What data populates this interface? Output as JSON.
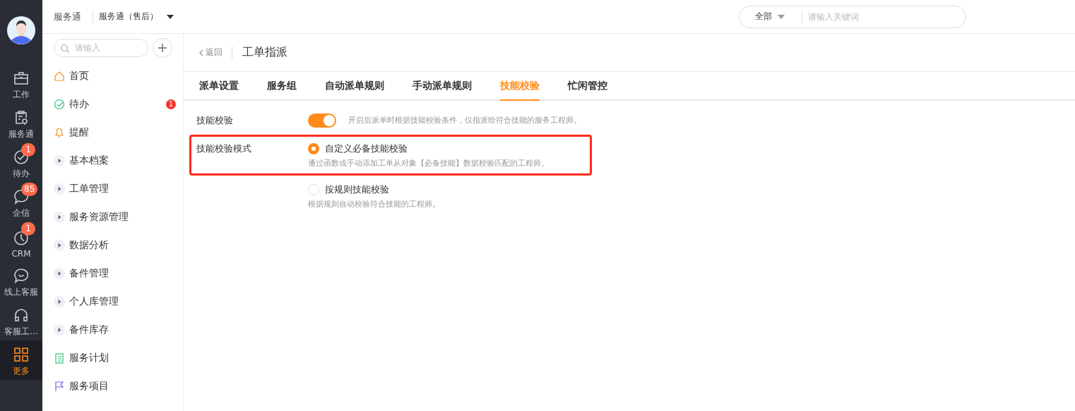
{
  "rail": [
    {
      "label": "工作",
      "selected": false
    },
    {
      "label": "服务通",
      "selected": false
    },
    {
      "label": "待办",
      "badge": "1",
      "selected": false
    },
    {
      "label": "企信",
      "badge": "85",
      "selected": false
    },
    {
      "label": "CRM",
      "badge": "1",
      "selected": false
    },
    {
      "label": "线上客服",
      "selected": false
    },
    {
      "label": "客服工…",
      "selected": false
    },
    {
      "label": "更多",
      "selected": true
    }
  ],
  "top_bar": {
    "app_name": "服务通",
    "app_switch": "服务通（售后）",
    "search": {
      "scope": "全部",
      "placeholder": "请输入关键词"
    }
  },
  "sidebar": {
    "search": {
      "placeholder": "请输入"
    },
    "items": [
      {
        "label": "首页"
      },
      {
        "label": "待办",
        "badge": "1"
      },
      {
        "label": "提醒"
      },
      {
        "label": "基本档案",
        "expanded": false
      },
      {
        "label": "工单管理",
        "expanded": false
      },
      {
        "label": "服务资源管理",
        "expanded": false
      },
      {
        "label": "数据分析",
        "expanded": false
      },
      {
        "label": "备件管理",
        "expanded": false
      },
      {
        "label": "个人库管理",
        "expanded": false
      },
      {
        "label": "备件库存",
        "expanded": false
      },
      {
        "label": "服务计划"
      },
      {
        "label": "服务项目"
      }
    ]
  },
  "page": {
    "back": "返回",
    "title": "工单指派"
  },
  "tabs": [
    {
      "label": "派单设置",
      "selected": false
    },
    {
      "label": "服务组",
      "selected": false
    },
    {
      "label": "自动派单规则",
      "selected": false
    },
    {
      "label": "手动派单规则",
      "selected": false
    },
    {
      "label": "技能校验",
      "selected": true
    },
    {
      "label": "忙闲管控",
      "selected": false
    }
  ],
  "settings": [
    {
      "kind": "toggle",
      "label": "技能校验",
      "on": true,
      "hint": "开启后派单时根据技能校验条件，仅指派给符合技能的服务工程师。"
    },
    {
      "kind": "radio",
      "label": "技能校验模式",
      "highlighted": true,
      "options": [
        {
          "label": "自定义必备技能校验",
          "hint": "通过函数或手动添加工单从对象【必备技能】数据校验匹配的工程师。",
          "selected": true
        }
      ]
    },
    {
      "kind": "radio",
      "options": [
        {
          "label": "按规则技能校验",
          "hint": "根据规则自动校验符合技能的工程师。",
          "selected": false
        }
      ]
    }
  ]
}
